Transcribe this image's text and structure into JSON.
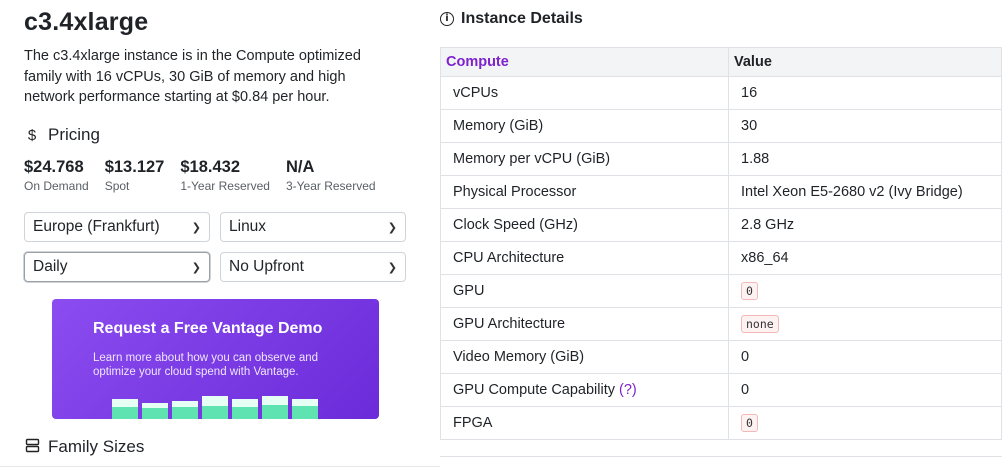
{
  "instance": {
    "title": "c3.4xlarge",
    "description": "The c3.4xlarge instance is in the Compute optimized family with 16 vCPUs, 30 GiB of memory and high network performance starting at $0.84 per hour."
  },
  "pricing": {
    "heading": "Pricing",
    "icon": "dollar-icon",
    "items": [
      {
        "value": "$24.768",
        "label": "On Demand"
      },
      {
        "value": "$13.127",
        "label": "Spot"
      },
      {
        "value": "$18.432",
        "label": "1-Year Reserved"
      },
      {
        "value": "N/A",
        "label": "3-Year Reserved"
      }
    ]
  },
  "filters": {
    "region": "Europe (Frankfurt)",
    "os": "Linux",
    "period": "Daily",
    "reservation": "No Upfront"
  },
  "promo": {
    "heading": "Request a Free Vantage Demo",
    "text": "Learn more about how you can observe and optimize your cloud spend with Vantage."
  },
  "family_sizes": {
    "heading": "Family Sizes",
    "icon": "stacked-boxes-icon"
  },
  "details": {
    "heading": "Instance Details",
    "icon": "info-circle-icon",
    "columns": [
      "Compute",
      "Value"
    ],
    "rows": [
      {
        "label": "vCPUs",
        "value": "16",
        "code": false
      },
      {
        "label": "Memory (GiB)",
        "value": "30",
        "code": false
      },
      {
        "label": "Memory per vCPU (GiB)",
        "value": "1.88",
        "code": false
      },
      {
        "label": "Physical Processor",
        "value": "Intel Xeon E5-2680 v2 (Ivy Bridge)",
        "code": false
      },
      {
        "label": "Clock Speed (GHz)",
        "value": "2.8 GHz",
        "code": false
      },
      {
        "label": "CPU Architecture",
        "value": "x86_64",
        "code": false
      },
      {
        "label": "GPU",
        "value": "0",
        "code": true
      },
      {
        "label": "GPU Architecture",
        "value": "none",
        "code": true
      },
      {
        "label": "Video Memory (GiB)",
        "value": "0",
        "code": false
      },
      {
        "label": "GPU Compute Capability",
        "value": "0",
        "code": false,
        "help": "(?)"
      },
      {
        "label": "FPGA",
        "value": "0",
        "code": true
      }
    ]
  },
  "colors": {
    "accent": "#7e22ce",
    "promo_start": "#8b4cf0",
    "promo_end": "#6b2bd9",
    "bar_green": "#5fe3b0"
  }
}
